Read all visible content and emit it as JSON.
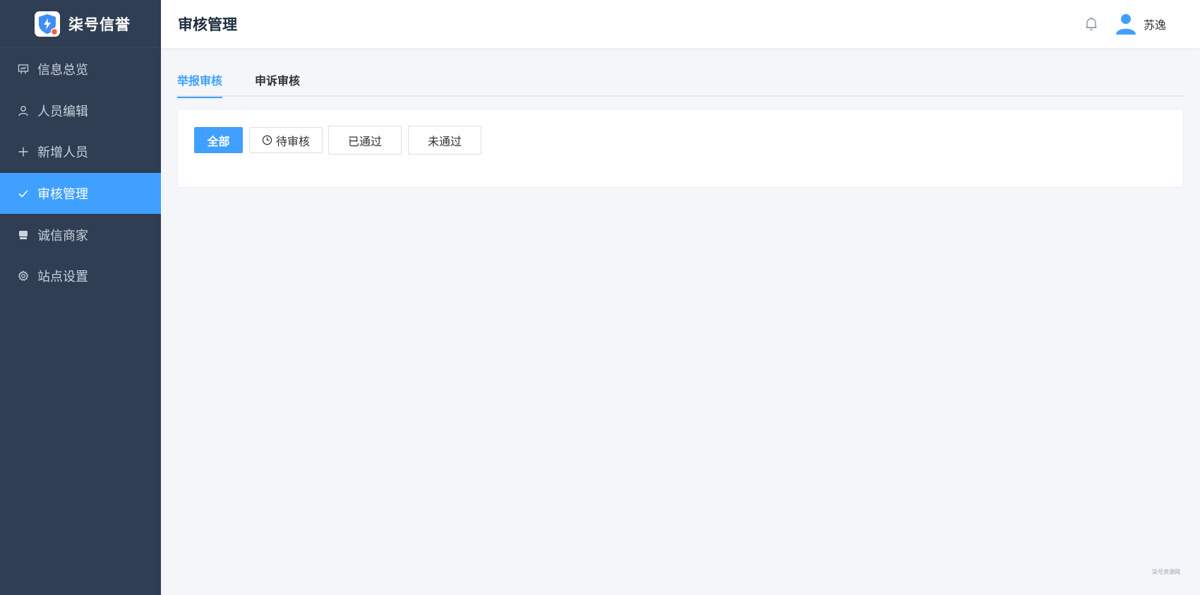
{
  "brand": {
    "name": "柒号信誉"
  },
  "sidebar": {
    "items": [
      {
        "label": "信息总览",
        "icon": "presentation-icon",
        "active": false
      },
      {
        "label": "人员编辑",
        "icon": "user-icon",
        "active": false
      },
      {
        "label": "新增人员",
        "icon": "plus-icon",
        "active": false
      },
      {
        "label": "审核管理",
        "icon": "check-icon",
        "active": true
      },
      {
        "label": "诚信商家",
        "icon": "shop-icon",
        "active": false
      },
      {
        "label": "站点设置",
        "icon": "gear-icon",
        "active": false
      }
    ]
  },
  "header": {
    "title": "审核管理",
    "username": "苏逸"
  },
  "tabs": [
    {
      "label": "举报审核",
      "active": true
    },
    {
      "label": "申诉审核",
      "active": false
    }
  ],
  "filters": [
    {
      "label": "全部",
      "selected": true
    },
    {
      "label": "待审核",
      "selected": false,
      "icon": "clock-icon"
    },
    {
      "label": "已通过",
      "selected": false
    },
    {
      "label": "未通过",
      "selected": false
    }
  ],
  "watermark": "柒号资源网",
  "colors": {
    "sidebar_bg": "#2f3e52",
    "accent": "#40a0ff",
    "page_bg": "#f4f6fa"
  }
}
